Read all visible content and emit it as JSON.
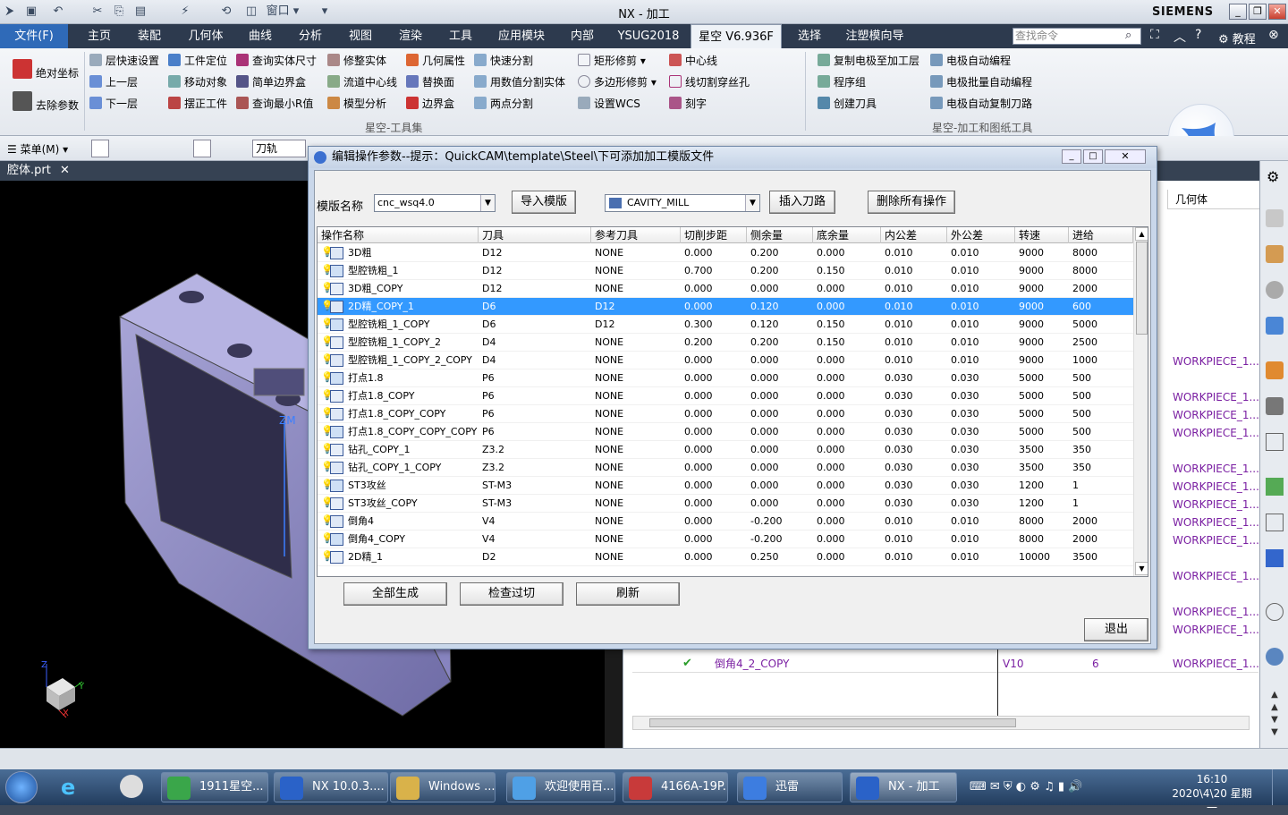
{
  "window": {
    "title": "NX - 加工",
    "brand": "SIEMENS"
  },
  "tabs": [
    {
      "label": "文件(F)"
    },
    {
      "label": "主页"
    },
    {
      "label": "装配"
    },
    {
      "label": "几何体"
    },
    {
      "label": "曲线"
    },
    {
      "label": "分析"
    },
    {
      "label": "视图"
    },
    {
      "label": "渲染"
    },
    {
      "label": "工具"
    },
    {
      "label": "应用模块"
    },
    {
      "label": "内部"
    },
    {
      "label": "YSUG2018"
    },
    {
      "label": "星空 V6.936F"
    },
    {
      "label": "选择"
    },
    {
      "label": "注塑模向导"
    }
  ],
  "command_search": {
    "placeholder": "查找命令"
  },
  "tutorial_label": "教程",
  "ribbon": {
    "col1": [
      "绝对坐标",
      "去除参数"
    ],
    "col2": [
      "层快速设置",
      "上一层",
      "下一层"
    ],
    "col3": [
      "工件定位",
      "移动对象",
      "摆正工件"
    ],
    "col4": [
      "查询实体尺寸",
      "简单边界盒",
      "查询最小R值"
    ],
    "col5": [
      "修整实体",
      "流道中心线",
      "模型分析"
    ],
    "col6": [
      "几何属性",
      "替换面",
      "边界盒"
    ],
    "col7": [
      "快速分割",
      "用数值分割实体",
      "两点分割"
    ],
    "col8": [
      "矩形修剪",
      "多边形修剪",
      "设置WCS"
    ],
    "col9": [
      "中心线",
      "线切割穿丝孔",
      "刻字"
    ],
    "col10": [
      "复制电极至加工层",
      "程序组",
      "创建刀具"
    ],
    "col11": [
      "电极自动编程",
      "电极批量自动编程",
      "电极自动复制刀路"
    ],
    "group1": "星空-工具集",
    "group2": "星空-加工和图纸工具"
  },
  "toolbar": {
    "menu_label": "菜单(M)",
    "filter_value": "刀轨"
  },
  "part_tab": "腔体.prt",
  "dialog": {
    "title": "编辑操作参数--提示：QuickCAM\\template\\Steel\\下可添加加工模版文件",
    "template_label": "模版名称",
    "template_value": "cnc_wsq4.0",
    "import_btn": "导入模版",
    "op_type": "CAVITY_MILL",
    "insert_btn": "插入刀路",
    "delete_btn": "删除所有操作",
    "columns": [
      "操作名称",
      "刀具",
      "参考刀具",
      "切削步距",
      "侧余量",
      "底余量",
      "内公差",
      "外公差",
      "转速",
      "进给"
    ],
    "rows": [
      [
        "3D粗",
        "D12",
        "NONE",
        "0.000",
        "0.200",
        "0.000",
        "0.010",
        "0.010",
        "9000",
        "8000"
      ],
      [
        "型腔铣粗_1",
        "D12",
        "NONE",
        "0.700",
        "0.200",
        "0.150",
        "0.010",
        "0.010",
        "9000",
        "8000"
      ],
      [
        "3D粗_COPY",
        "D12",
        "NONE",
        "0.000",
        "0.000",
        "0.000",
        "0.010",
        "0.010",
        "9000",
        "2000"
      ],
      [
        "2D精_COPY_1",
        "D6",
        "D12",
        "0.000",
        "0.120",
        "0.000",
        "0.010",
        "0.010",
        "9000",
        "600"
      ],
      [
        "型腔铣粗_1_COPY",
        "D6",
        "D12",
        "0.300",
        "0.120",
        "0.150",
        "0.010",
        "0.010",
        "9000",
        "5000"
      ],
      [
        "型腔铣粗_1_COPY_2",
        "D4",
        "NONE",
        "0.200",
        "0.200",
        "0.150",
        "0.010",
        "0.010",
        "9000",
        "2500"
      ],
      [
        "型腔铣粗_1_COPY_2_COPY",
        "D4",
        "NONE",
        "0.000",
        "0.000",
        "0.000",
        "0.010",
        "0.010",
        "9000",
        "1000"
      ],
      [
        "打点1.8",
        "P6",
        "NONE",
        "0.000",
        "0.000",
        "0.000",
        "0.030",
        "0.030",
        "5000",
        "500"
      ],
      [
        "打点1.8_COPY",
        "P6",
        "NONE",
        "0.000",
        "0.000",
        "0.000",
        "0.030",
        "0.030",
        "5000",
        "500"
      ],
      [
        "打点1.8_COPY_COPY",
        "P6",
        "NONE",
        "0.000",
        "0.000",
        "0.000",
        "0.030",
        "0.030",
        "5000",
        "500"
      ],
      [
        "打点1.8_COPY_COPY_COPY",
        "P6",
        "NONE",
        "0.000",
        "0.000",
        "0.000",
        "0.030",
        "0.030",
        "5000",
        "500"
      ],
      [
        "钻孔_COPY_1",
        "Z3.2",
        "NONE",
        "0.000",
        "0.000",
        "0.000",
        "0.030",
        "0.030",
        "3500",
        "350"
      ],
      [
        "钻孔_COPY_1_COPY",
        "Z3.2",
        "NONE",
        "0.000",
        "0.000",
        "0.000",
        "0.030",
        "0.030",
        "3500",
        "350"
      ],
      [
        "ST3攻丝",
        "ST-M3",
        "NONE",
        "0.000",
        "0.000",
        "0.000",
        "0.030",
        "0.030",
        "1200",
        "1"
      ],
      [
        "ST3攻丝_COPY",
        "ST-M3",
        "NONE",
        "0.000",
        "0.000",
        "0.000",
        "0.030",
        "0.030",
        "1200",
        "1"
      ],
      [
        "倒角4",
        "V4",
        "NONE",
        "0.000",
        "-0.200",
        "0.000",
        "0.010",
        "0.010",
        "8000",
        "2000"
      ],
      [
        "倒角4_COPY",
        "V4",
        "NONE",
        "0.000",
        "-0.200",
        "0.000",
        "0.010",
        "0.010",
        "8000",
        "2000"
      ],
      [
        "2D精_1",
        "D2",
        "NONE",
        "0.000",
        "0.250",
        "0.000",
        "0.010",
        "0.010",
        "10000",
        "3500"
      ]
    ],
    "selected_row": 3,
    "gen_all_btn": "全部生成",
    "check_btn": "检查过切",
    "refresh_btn": "刷新",
    "exit_btn": "退出"
  },
  "right_panel": {
    "header": "几何体",
    "workpiece": "WORKPIECE_1...",
    "bottom_row": {
      "name": "倒角4_2_COPY",
      "tool": "V10",
      "count": "6"
    }
  },
  "taskbar": {
    "items": [
      "1911星空...",
      "NX 10.0.3....",
      "Windows ...",
      "欢迎使用百...",
      "4166A-19P...",
      "迅雷",
      "NX - 加工"
    ],
    "time": "16:10",
    "date": "2020\\4\\20 星期一"
  },
  "axis_labels": {
    "zm": "ZM"
  }
}
